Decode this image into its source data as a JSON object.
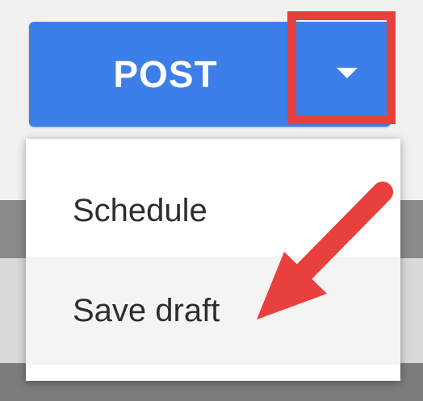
{
  "split_button": {
    "primary_label": "POST"
  },
  "dropdown": {
    "items": [
      {
        "label": "Schedule"
      },
      {
        "label": "Save draft"
      }
    ]
  },
  "colors": {
    "button_blue": "#3d7fe8",
    "annotation_red": "#e8403d",
    "menu_background": "#ffffff"
  }
}
